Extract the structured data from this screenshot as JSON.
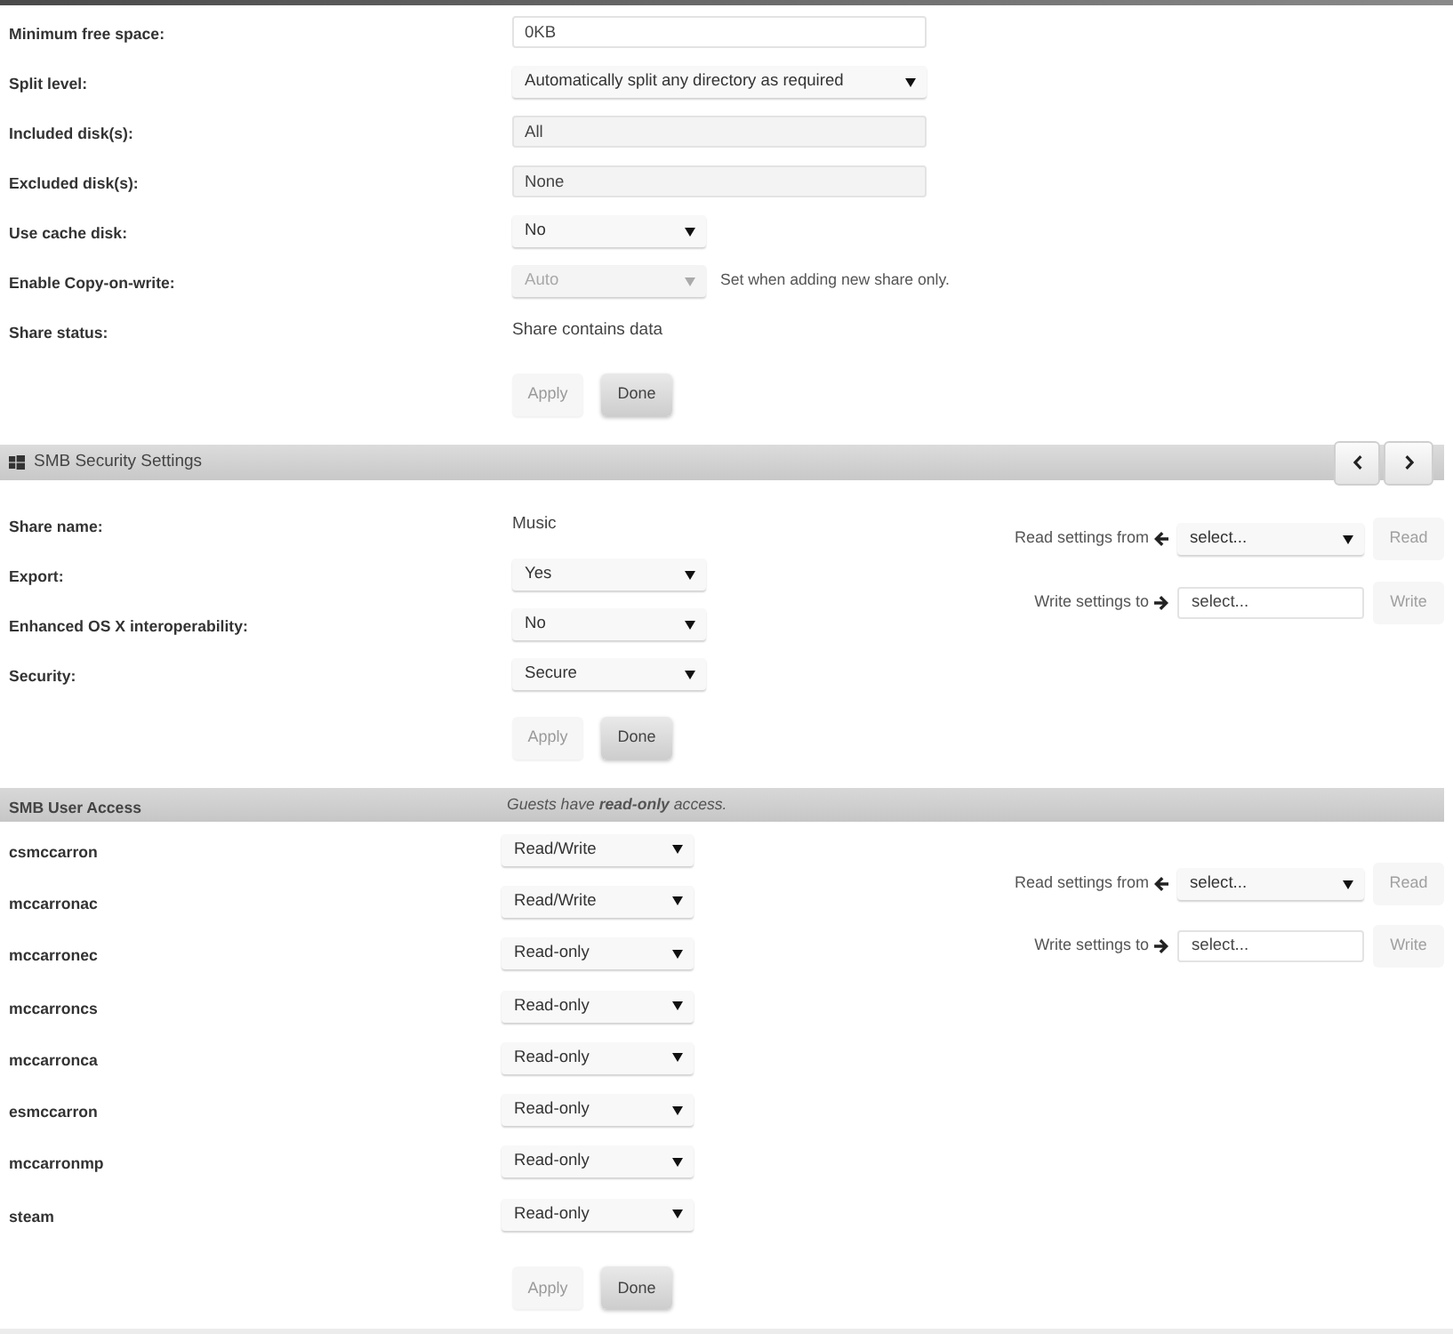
{
  "share_settings": {
    "fields": [
      {
        "label": "Minimum free space:",
        "kind": "input",
        "value": "0KB",
        "disabled": false
      },
      {
        "label": "Split level:",
        "kind": "wide_select",
        "value": "Automatically split any directory as required",
        "disabled": false
      },
      {
        "label": "Included disk(s):",
        "kind": "picker",
        "value": "All",
        "disabled": false
      },
      {
        "label": "Excluded disk(s):",
        "kind": "picker",
        "value": "None",
        "disabled": false
      },
      {
        "label": "Use cache disk:",
        "kind": "select",
        "value": "No",
        "disabled": false
      },
      {
        "label": "Enable Copy-on-write:",
        "kind": "select",
        "value": "Auto",
        "disabled": true,
        "note": "Set when adding new share only."
      },
      {
        "label": "Share status:",
        "kind": "static",
        "value": "Share contains data",
        "disabled": false
      }
    ],
    "buttons": [
      {
        "label": "Apply",
        "disabled": true
      },
      {
        "label": "Done",
        "disabled": false
      }
    ]
  },
  "smb_security": {
    "title": "SMB Security Settings",
    "fields": [
      {
        "label": "Share name:",
        "kind": "static",
        "value": "Music",
        "disabled": false
      },
      {
        "label": "Export:",
        "kind": "select",
        "value": "Yes",
        "disabled": false
      },
      {
        "label": "Enhanced OS X interoperability:",
        "kind": "select",
        "value": "No",
        "disabled": false
      },
      {
        "label": "Security:",
        "kind": "select",
        "value": "Secure",
        "disabled": false
      }
    ],
    "copy_settings": [
      {
        "kind": "read",
        "label": "Read settings from",
        "value": "select...",
        "button": {
          "label": "Read",
          "disabled": true
        }
      },
      {
        "kind": "write",
        "label": "Write settings to",
        "value": "select...",
        "button": {
          "label": "Write",
          "disabled": true
        }
      }
    ],
    "buttons": [
      {
        "label": "Apply",
        "disabled": true
      },
      {
        "label": "Done",
        "disabled": false
      }
    ]
  },
  "smb_user_access": {
    "title": "SMB User Access",
    "note": "Guests have **read-only** access.",
    "users": [
      {
        "name": "csmccarron",
        "access": "Read/Write"
      },
      {
        "name": "mccarronac",
        "access": "Read/Write"
      },
      {
        "name": "mccarronec",
        "access": "Read-only"
      },
      {
        "name": "mccarroncs",
        "access": "Read-only"
      },
      {
        "name": "mccarronca",
        "access": "Read-only"
      },
      {
        "name": "esmccarron",
        "access": "Read-only"
      },
      {
        "name": "mccarronmp",
        "access": "Read-only"
      },
      {
        "name": "steam",
        "access": "Read-only"
      }
    ],
    "copy_settings": [
      {
        "kind": "read",
        "label": "Read settings from",
        "value": "select...",
        "button": {
          "label": "Read",
          "disabled": true
        }
      },
      {
        "kind": "write",
        "label": "Write settings to",
        "value": "select...",
        "button": {
          "label": "Write",
          "disabled": true
        }
      }
    ],
    "buttons": [
      {
        "label": "Apply",
        "disabled": true
      },
      {
        "label": "Done",
        "disabled": false
      }
    ]
  }
}
